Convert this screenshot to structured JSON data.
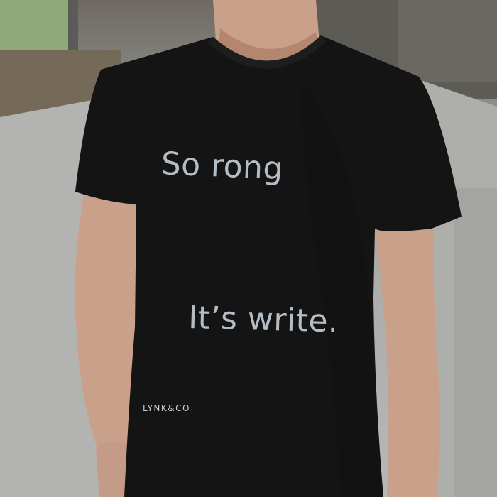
{
  "tshirt_print": {
    "line1": "So rong",
    "line2": "It’s write."
  },
  "brand": {
    "label": "LYNK&CO"
  },
  "colors": {
    "shirt": "#141414",
    "print": "#b4bcc4",
    "skin": "#c9a08a",
    "wall": "#b2b3b0"
  }
}
